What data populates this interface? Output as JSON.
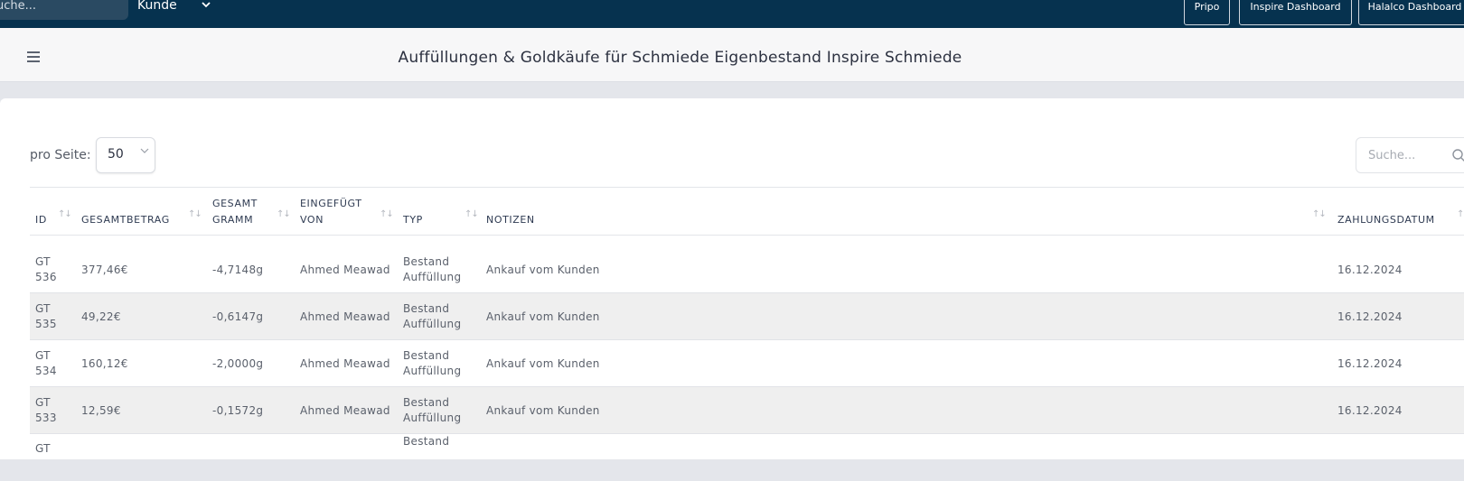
{
  "topbar": {
    "search_placeholder": "uche...",
    "customer_select": "Kunde",
    "buttons": [
      "Pripo",
      "Inspire Dashboard",
      "Halalco Dashboard"
    ]
  },
  "header": {
    "title": "Auffüllungen & Goldkäufe für Schmiede Eigenbestand Inspire Schmiede"
  },
  "controls": {
    "per_page_label": "pro Seite:",
    "per_page_value": "50",
    "search_placeholder": "Suche..."
  },
  "table": {
    "columns": [
      {
        "key": "id",
        "line1": "ID",
        "line2": ""
      },
      {
        "key": "total",
        "line1": "GESAMTBETRAG",
        "line2": ""
      },
      {
        "key": "grams",
        "line1": "GESAMT",
        "line2": "GRAMM"
      },
      {
        "key": "by",
        "line1": "EINGEFÜGT",
        "line2": "VON"
      },
      {
        "key": "type",
        "line1": "TYP",
        "line2": ""
      },
      {
        "key": "notes",
        "line1": "NOTIZEN",
        "line2": ""
      },
      {
        "key": "date",
        "line1": "ZAHLUNGSDATUM",
        "line2": ""
      }
    ],
    "rows": [
      {
        "id1": "GT",
        "id2": "536",
        "total": "377,46€",
        "grams": "-4,7148g",
        "by": "Ahmed Meawad",
        "type1": "Bestand",
        "type2": "Auffüllung",
        "notes": "Ankauf vom Kunden",
        "date": "16.12.2024"
      },
      {
        "id1": "GT",
        "id2": "535",
        "total": "49,22€",
        "grams": "-0,6147g",
        "by": "Ahmed Meawad",
        "type1": "Bestand",
        "type2": "Auffüllung",
        "notes": "Ankauf vom Kunden",
        "date": "16.12.2024"
      },
      {
        "id1": "GT",
        "id2": "534",
        "total": "160,12€",
        "grams": "-2,0000g",
        "by": "Ahmed Meawad",
        "type1": "Bestand",
        "type2": "Auffüllung",
        "notes": "Ankauf vom Kunden",
        "date": "16.12.2024"
      },
      {
        "id1": "GT",
        "id2": "533",
        "total": "12,59€",
        "grams": "-0,1572g",
        "by": "Ahmed Meawad",
        "type1": "Bestand",
        "type2": "Auffüllung",
        "notes": "Ankauf vom Kunden",
        "date": "16.12.2024"
      },
      {
        "id1": "GT",
        "id2": "",
        "total": "",
        "grams": "",
        "by": "",
        "type1": "Bestand",
        "type2": "",
        "notes": "",
        "date": ""
      }
    ]
  },
  "colors": {
    "topbar": "#06324f",
    "header_text": "#2c3140",
    "alt_row": "#efefef"
  },
  "icons": [
    "hamburger-icon",
    "chevron-down-icon",
    "search-icon",
    "sort-icon"
  ]
}
